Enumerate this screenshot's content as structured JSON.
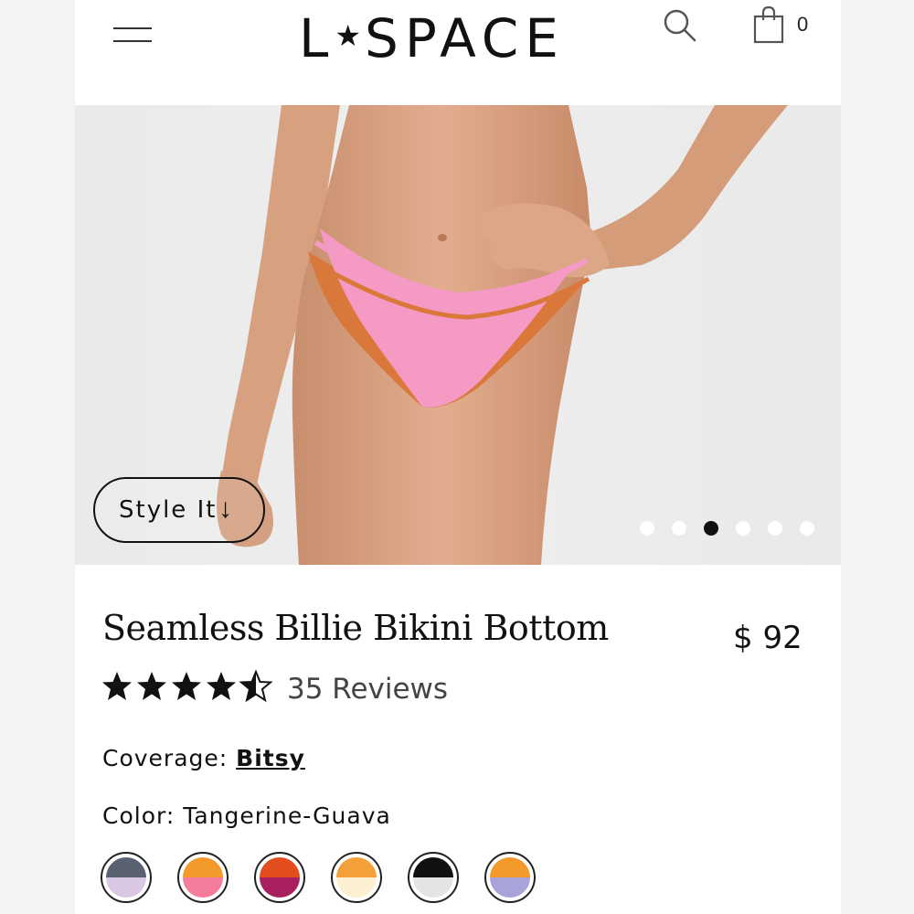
{
  "header": {
    "logo_text": "L★SPACE",
    "logo_left": "L",
    "logo_star": "★",
    "logo_right": "SPACE",
    "cart_count": "0",
    "icons": [
      "menu-icon",
      "search-icon",
      "shopping-bag-icon"
    ]
  },
  "hero": {
    "style_button_label": "Style It",
    "style_button_arrow": "↓",
    "carousel_count": 6,
    "carousel_active_index": 2
  },
  "product": {
    "title": "Seamless Billie Bikini Bottom",
    "price": "$ 92",
    "rating": 4.5,
    "rating_max": 5,
    "reviews_label": "35 Reviews",
    "coverage_label": "Coverage:",
    "coverage_value": "Bitsy",
    "color_label": "Color:",
    "color_value": "Tangerine-Guava"
  },
  "swatches": [
    {
      "name": "swatch-1",
      "top": "#5a6170",
      "bottom": "#d9c7e4"
    },
    {
      "name": "swatch-2",
      "top": "#f39a2a",
      "bottom": "#f47c9a"
    },
    {
      "name": "swatch-3",
      "top": "#e24e1e",
      "bottom": "#a8205e"
    },
    {
      "name": "swatch-4",
      "top": "#f3a03a",
      "bottom": "#fbf1d0"
    },
    {
      "name": "swatch-5",
      "top": "#111111",
      "bottom": "#e4e4e4"
    },
    {
      "name": "swatch-6",
      "top": "#f39a2a",
      "bottom": "#a8a3d8"
    }
  ],
  "colors": {
    "bikini_pink": "#f59ac4",
    "bikini_orange": "#d9783a",
    "skin": "#d9a383"
  }
}
